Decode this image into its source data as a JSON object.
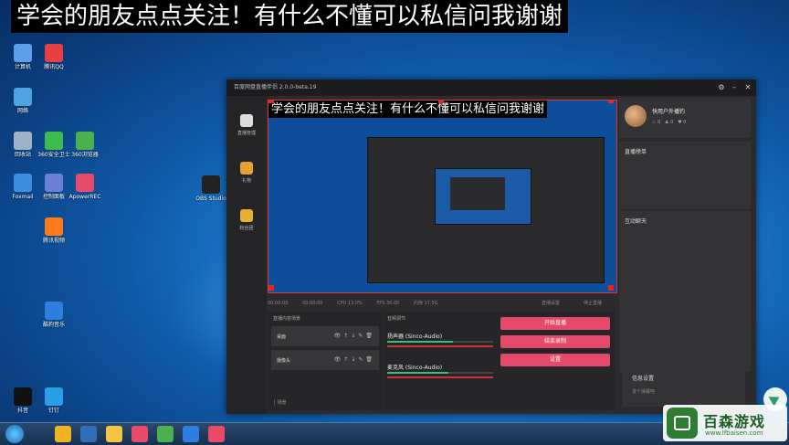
{
  "banner": "学会的朋友点点关注！有什么不懂可以私信问我谢谢",
  "desktop_icons": [
    {
      "label": "计算机",
      "color": "#5aa0e8"
    },
    {
      "label": "腾讯QQ",
      "color": "#e84040"
    },
    {
      "label": "网络",
      "color": "#4fa3e0"
    },
    {
      "label": "回收站",
      "color": "#9fb3c8"
    },
    {
      "label": "Foxmail",
      "color": "#3d8de0"
    },
    {
      "label": "控制面板",
      "color": "#6a7fd8"
    },
    {
      "label": "360安全卫士",
      "color": "#3dbb4f"
    },
    {
      "label": "360浏览器",
      "color": "#4caf50"
    },
    {
      "label": "ApowerREC",
      "color": "#e84a6a"
    },
    {
      "label": "OBS Studio",
      "color": "#222222"
    },
    {
      "label": "腾讯视频",
      "color": "#ff7a1a"
    },
    {
      "label": "酷狗音乐",
      "color": "#2f7de1"
    },
    {
      "label": "钉钉",
      "color": "#2a9fe8"
    },
    {
      "label": "抖音",
      "color": "#111111"
    }
  ],
  "window": {
    "title": "百度网盘直播伴侣 2.0.0-beta.19",
    "sidebar": [
      {
        "label": "直播管理",
        "icon": "user-icon"
      },
      {
        "label": "礼物",
        "icon": "gift-icon"
      },
      {
        "label": "粉丝团",
        "icon": "crown-icon"
      }
    ],
    "preview_banner": "学会的朋友点点关注！有什么不懂可以私信问我谢谢",
    "status": [
      "00:00:00",
      "00:00:00",
      "CPU 13.0%",
      "FPS 30.00",
      "内存 17.5G"
    ],
    "status_right": [
      "直播设置",
      "停止直播"
    ],
    "profile": {
      "name": "快用户外播钓",
      "stats": [
        "0",
        "0",
        "0"
      ]
    },
    "panels": [
      "直播榜单",
      "互动聊天"
    ],
    "scenes": {
      "header": "直播内容场景",
      "items": [
        "桌面",
        "摄像头"
      ],
      "footer": "场景"
    },
    "mixer": {
      "header": "音频调节",
      "tracks": [
        {
          "name": "扬声器 (Sinco-Audio)",
          "level": 0.62
        },
        {
          "name": "麦克风 (Sinco-Audio)",
          "level": 0.58
        }
      ]
    },
    "actions": [
      "开始直播",
      "结束录制",
      "设置"
    ],
    "info": {
      "title": "信息设置",
      "subtitle": "发个弹幕吧"
    }
  },
  "watermark": {
    "title": "百森游戏",
    "subtitle": "www.lfbaisen.com"
  },
  "taskbar_apps": [
    "#f0b323",
    "#2f6fb8",
    "#f5c542",
    "#e84a6a",
    "#4caf50",
    "#2f7de1",
    "#e84a6a"
  ]
}
